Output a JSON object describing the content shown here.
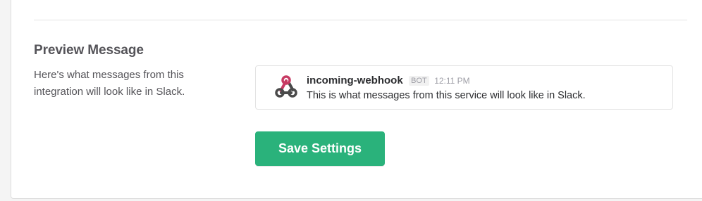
{
  "preview_section": {
    "title": "Preview Message",
    "description": "Here's what messages from this integration will look like in Slack."
  },
  "message": {
    "bot_name": "incoming-webhook",
    "badge": "BOT",
    "timestamp": "12:11 PM",
    "text": "This is what messages from this service will look like in Slack.",
    "avatar_icon": "webhook-icon"
  },
  "actions": {
    "save_label": "Save Settings"
  },
  "colors": {
    "save_button": "#2ab27b",
    "webhook_dark": "#4a4a4a",
    "webhook_pink": "#c73a63"
  }
}
